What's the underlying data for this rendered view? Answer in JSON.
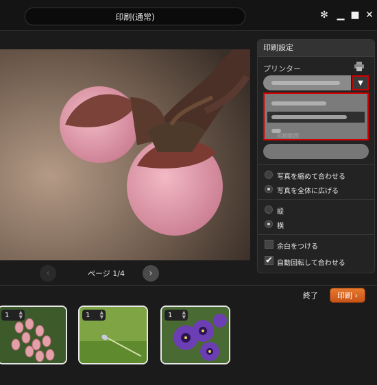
{
  "window": {
    "title": "印刷(通常)"
  },
  "pager": {
    "label": "ページ 1/4"
  },
  "settings": {
    "header": "印刷設定",
    "printer_label": "プリンター",
    "dropdown_hidden_label": "印刷範囲",
    "fit_options": [
      "写真を縮めて合わせる",
      "写真を全体に広げる"
    ],
    "fit_selected": 1,
    "orientation_options": [
      "縦",
      "横"
    ],
    "orientation_selected": 1,
    "margin_label": "余白をつける",
    "margin_checked": false,
    "autorotate_label": "自動回転して合わせる",
    "autorotate_checked": true
  },
  "footer": {
    "end_label": "終了",
    "print_label": "印刷"
  },
  "thumbnails": [
    {
      "count": "1",
      "subject": "pieris flowers"
    },
    {
      "count": "1",
      "subject": "crocus bud"
    },
    {
      "count": "1",
      "subject": "purple pansies"
    }
  ],
  "colors": {
    "accent": "#d9641f",
    "highlight": "#d40000"
  }
}
